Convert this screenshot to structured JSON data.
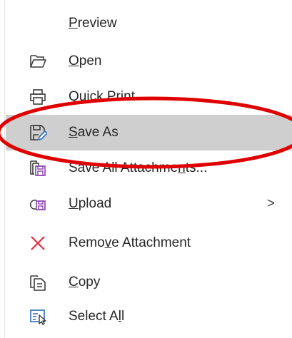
{
  "menu": {
    "items": [
      {
        "id": "preview",
        "pre": "",
        "u": "P",
        "post": "review",
        "icon": "none",
        "selected": false,
        "submenu": false
      },
      {
        "id": "open",
        "pre": "",
        "u": "O",
        "post": "pen",
        "icon": "folder-open-icon",
        "selected": false,
        "submenu": false
      },
      {
        "id": "quick-print",
        "pre": "",
        "u": "",
        "post": "Quick Print",
        "icon": "printer-icon",
        "selected": false,
        "submenu": false
      },
      {
        "id": "save-as",
        "pre": "",
        "u": "S",
        "post": "ave As",
        "icon": "save-as-icon",
        "selected": true,
        "submenu": false
      },
      {
        "id": "save-all-attachments",
        "pre": "Save All Attachme",
        "u": "n",
        "post": "ts...",
        "icon": "save-all-attachments-icon",
        "selected": false,
        "submenu": false
      },
      {
        "id": "upload",
        "pre": "",
        "u": "U",
        "post": "pload",
        "icon": "upload-icon",
        "selected": false,
        "submenu": true
      },
      {
        "id": "remove-attachment",
        "pre": "Remo",
        "u": "v",
        "post": "e Attachment",
        "icon": "remove-x-icon",
        "selected": false,
        "submenu": false
      },
      {
        "id": "copy",
        "pre": "",
        "u": "C",
        "post": "opy",
        "icon": "copy-icon",
        "selected": false,
        "submenu": false
      },
      {
        "id": "select-all",
        "pre": "Select A",
        "u": "l",
        "post": "l",
        "icon": "select-all-icon",
        "selected": false,
        "submenu": false
      }
    ],
    "submenu_glyph": ">"
  },
  "colors": {
    "selected_bg": "#cfcfcf",
    "text": "#262626",
    "icon": "#3c3c3c",
    "icon_accent_blue": "#2b6cb8",
    "remove_red": "#e8253a",
    "annotation_red": "#e00000"
  }
}
